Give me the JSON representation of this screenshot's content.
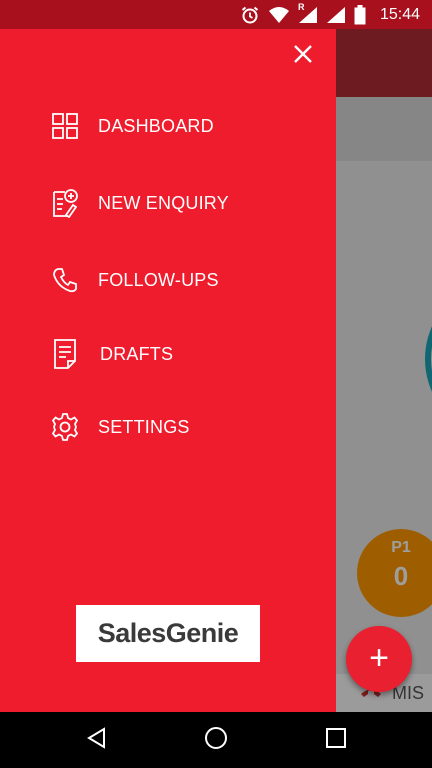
{
  "status_bar": {
    "time": "15:44",
    "network_badge": "R",
    "icons": [
      "alarm-icon",
      "wifi-icon",
      "signal-icon",
      "signal-icon",
      "battery-icon"
    ]
  },
  "background_app": {
    "p1_label": "P1",
    "p1_value": "0",
    "fab_label": "+",
    "peek_text": "MIS"
  },
  "drawer": {
    "menu": [
      {
        "label": "DASHBOARD",
        "icon": "grid-icon"
      },
      {
        "label": "NEW ENQUIRY",
        "icon": "add-document-icon"
      },
      {
        "label": "FOLLOW-UPS",
        "icon": "phone-icon"
      },
      {
        "label": "DRAFTS",
        "icon": "draft-icon"
      },
      {
        "label": "SETTINGS",
        "icon": "gear-icon"
      }
    ],
    "logo_text": "SalesGenie"
  },
  "colors": {
    "drawer_bg": "#ee1c2d",
    "status_bar_bg": "#a8101d",
    "text": "#ffffff"
  },
  "nav_bar": {
    "buttons": [
      "back-icon",
      "home-icon",
      "recents-icon"
    ]
  }
}
